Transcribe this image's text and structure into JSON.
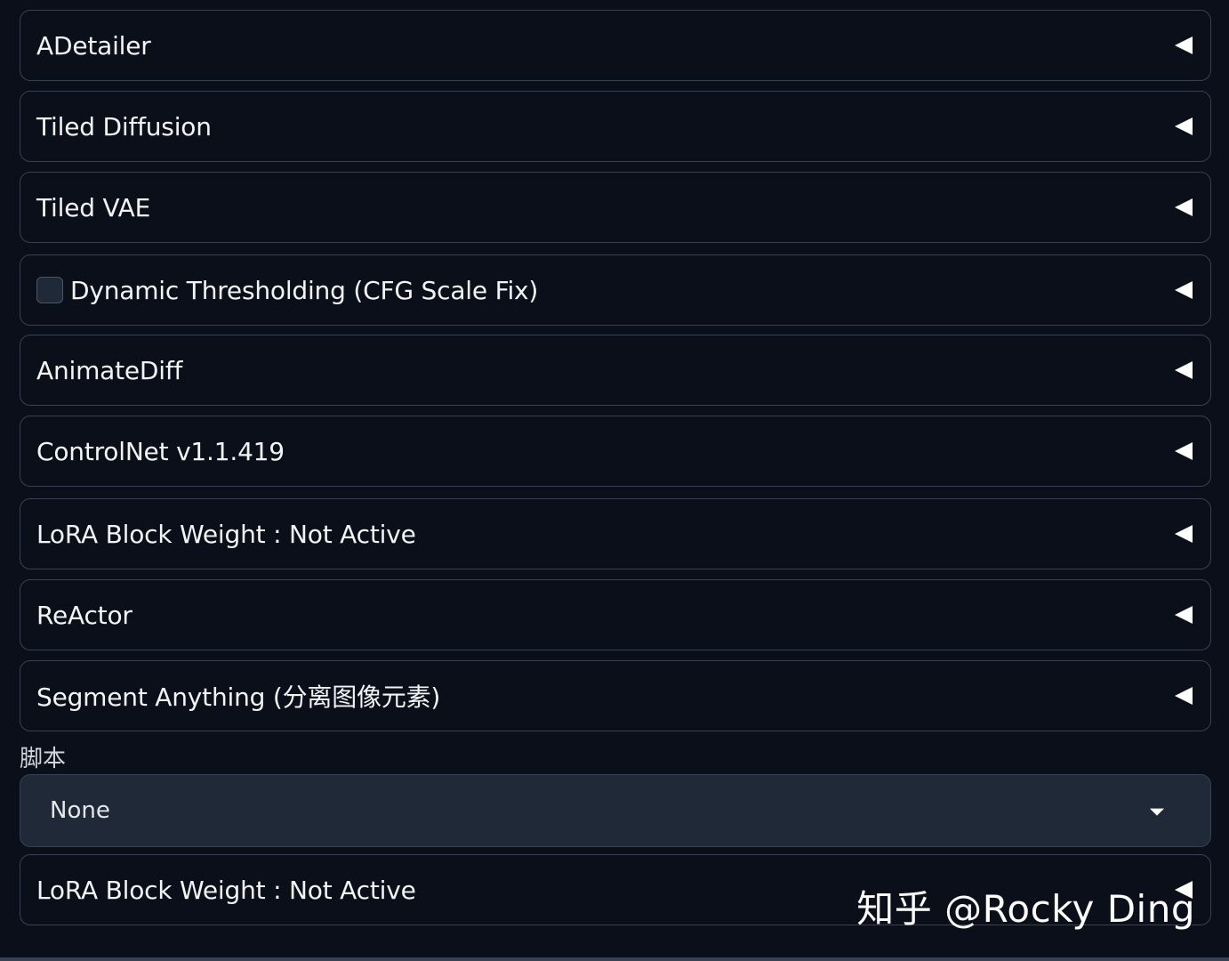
{
  "accordions": [
    {
      "label": "ADetailer"
    },
    {
      "label": "Tiled Diffusion"
    },
    {
      "label": "Tiled VAE"
    },
    {
      "label": "Dynamic Thresholding (CFG Scale Fix)",
      "checked": false
    },
    {
      "label": "AnimateDiff"
    },
    {
      "label": "ControlNet v1.1.419"
    },
    {
      "label": "LoRA Block Weight : Not Active"
    },
    {
      "label": "ReActor"
    },
    {
      "label": "Segment Anything (分离图像元素)"
    }
  ],
  "script": {
    "label": "脚本",
    "selected": "None"
  },
  "bottom_accordion": {
    "label": "LoRA Block Weight : Not Active"
  },
  "watermark": "知乎 @Rocky Ding"
}
